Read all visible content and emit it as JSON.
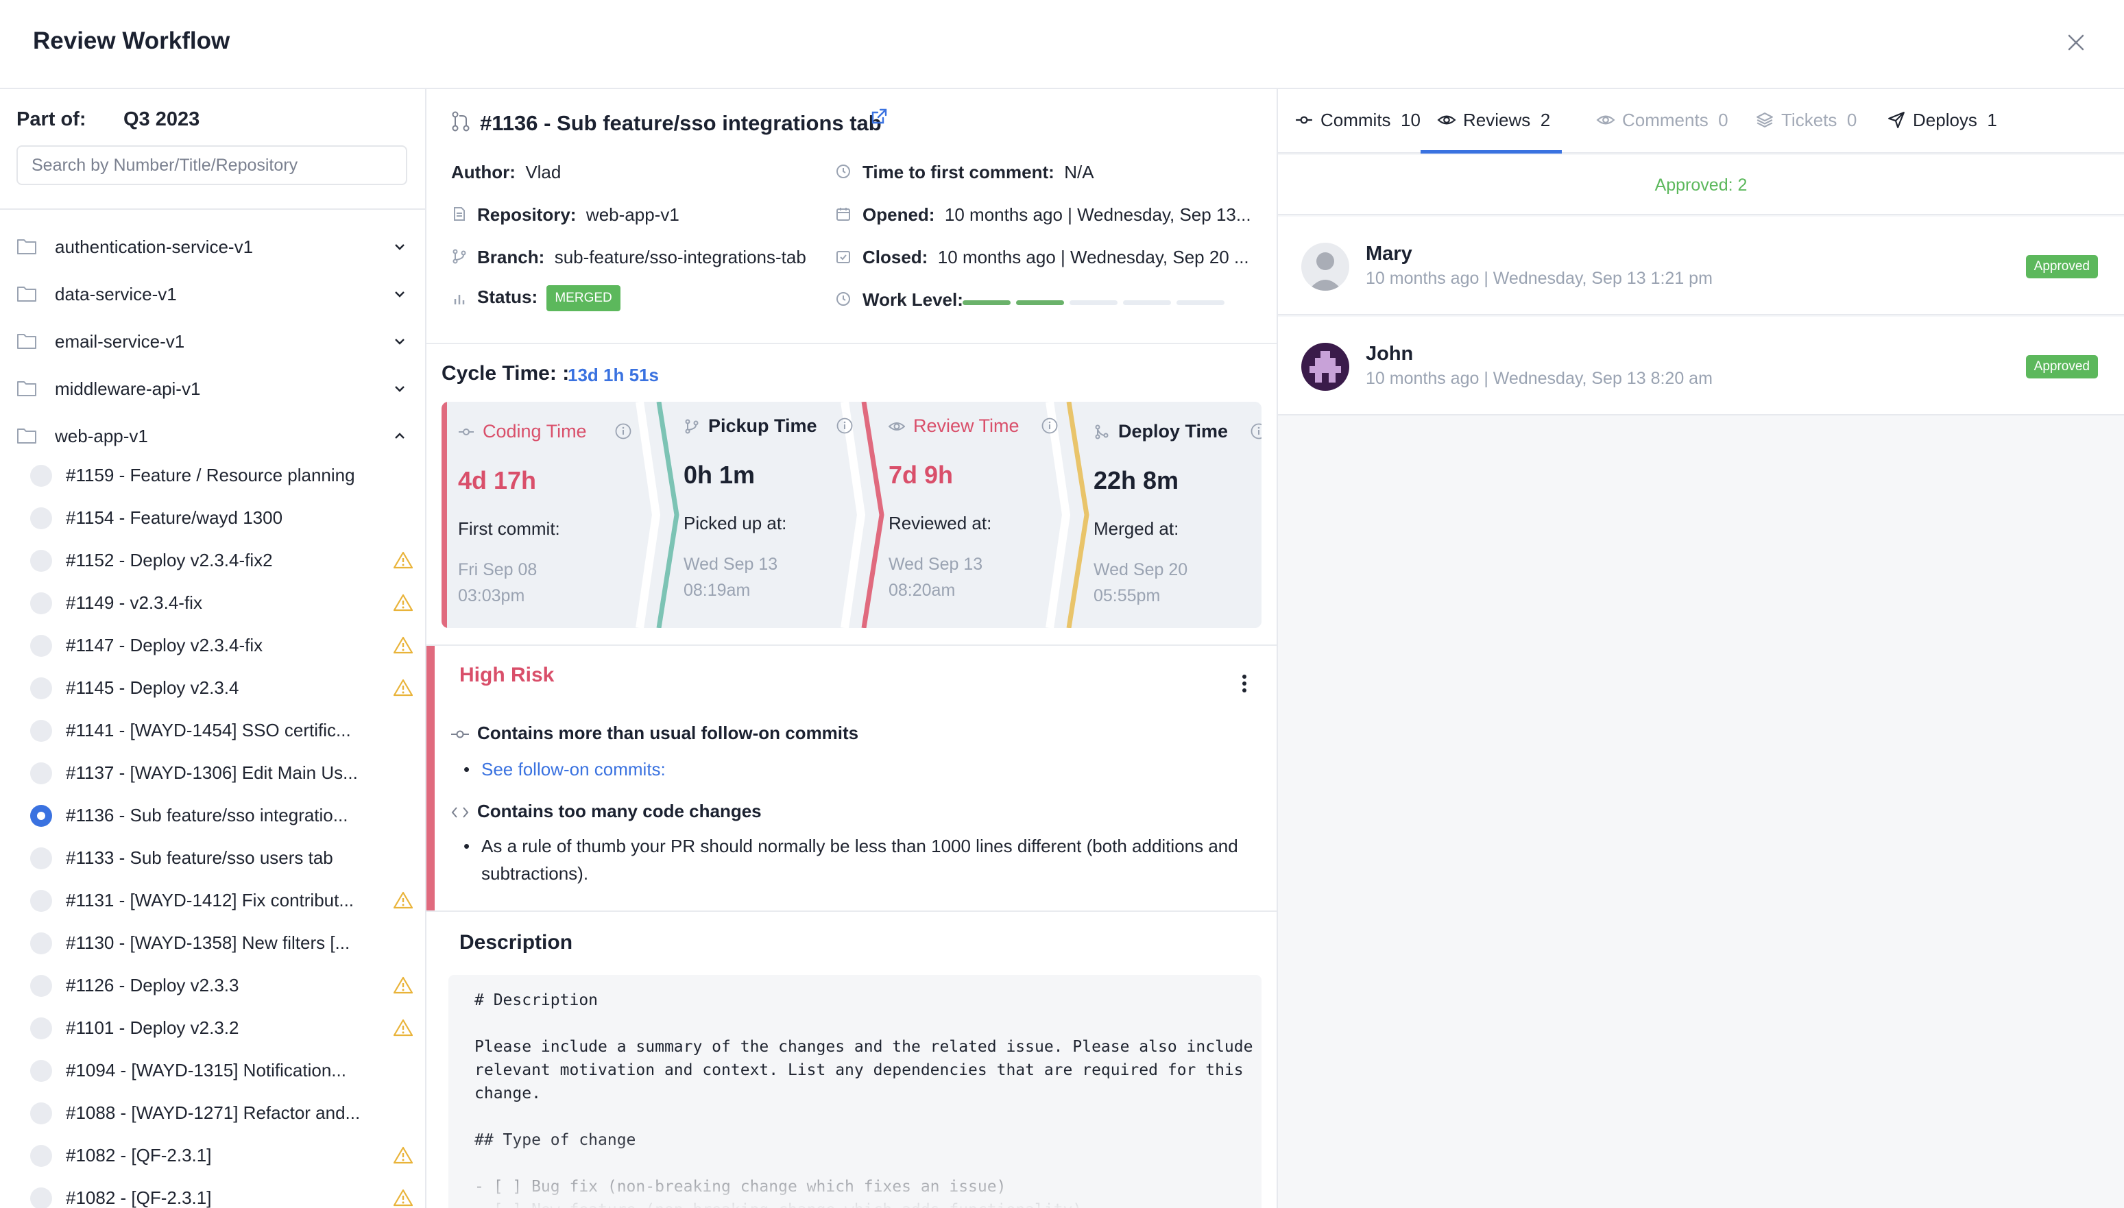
{
  "header": {
    "title": "Review Workflow"
  },
  "left": {
    "part_of_label": "Part of:",
    "part_of_value": "Q3 2023",
    "search_placeholder": "Search by Number/Title/Repository",
    "repos": [
      {
        "name": "authentication-service-v1",
        "expanded": false
      },
      {
        "name": "data-service-v1",
        "expanded": false
      },
      {
        "name": "email-service-v1",
        "expanded": false
      },
      {
        "name": "middleware-api-v1",
        "expanded": false
      },
      {
        "name": "web-app-v1",
        "expanded": true
      }
    ],
    "prs": [
      {
        "title": "#1159 - Feature / Resource planning",
        "warning": false,
        "selected": false
      },
      {
        "title": "#1154 - Feature/wayd 1300",
        "warning": false,
        "selected": false
      },
      {
        "title": "#1152 - Deploy v2.3.4-fix2",
        "warning": true,
        "selected": false
      },
      {
        "title": "#1149 - v2.3.4-fix",
        "warning": true,
        "selected": false
      },
      {
        "title": "#1147 - Deploy v2.3.4-fix",
        "warning": true,
        "selected": false
      },
      {
        "title": "#1145 - Deploy v2.3.4",
        "warning": true,
        "selected": false
      },
      {
        "title": "#1141 - [WAYD-1454] SSO certific...",
        "warning": false,
        "selected": false
      },
      {
        "title": "#1137 - [WAYD-1306] Edit Main Us...",
        "warning": false,
        "selected": false
      },
      {
        "title": "#1136 - Sub feature/sso integratio...",
        "warning": false,
        "selected": true
      },
      {
        "title": "#1133 - Sub feature/sso users tab",
        "warning": false,
        "selected": false
      },
      {
        "title": "#1131 - [WAYD-1412] Fix contribut...",
        "warning": true,
        "selected": false
      },
      {
        "title": "#1130 - [WAYD-1358] New filters [...",
        "warning": false,
        "selected": false
      },
      {
        "title": "#1126 - Deploy v2.3.3",
        "warning": true,
        "selected": false
      },
      {
        "title": "#1101 - Deploy v2.3.2",
        "warning": true,
        "selected": false
      },
      {
        "title": "#1094 - [WAYD-1315] Notification...",
        "warning": false,
        "selected": false
      },
      {
        "title": "#1088 - [WAYD-1271] Refactor and...",
        "warning": false,
        "selected": false
      },
      {
        "title": "#1082 - [QF-2.3.1]",
        "warning": true,
        "selected": false
      },
      {
        "title": "#1082 - [QF-2.3.1]",
        "warning": true,
        "selected": false
      }
    ]
  },
  "pr": {
    "title": "#1136 - Sub feature/sso integrations tab",
    "author_label": "Author:",
    "author": "Vlad",
    "repo_label": "Repository:",
    "repo": "web-app-v1",
    "branch_label": "Branch:",
    "branch": "sub-feature/sso-integrations-tab",
    "status_label": "Status:",
    "status": "MERGED",
    "ttfc_label": "Time to first comment:",
    "ttfc": "N/A",
    "opened_label": "Opened:",
    "opened": "10 months ago | Wednesday, Sep 13...",
    "closed_label": "Closed:",
    "closed": "10 months ago | Wednesday, Sep 20 ...",
    "work_level_label": "Work Level:",
    "work_level": 0.4
  },
  "cycle": {
    "title": "Cycle Time: :",
    "total": "13d 1h 51s",
    "stages": [
      {
        "name": "Coding Time",
        "value": "4d 17h",
        "label": "First commit:",
        "date1": "Fri Sep 08",
        "date2": "03:03pm",
        "color": "#e06a7e",
        "icon": "commit-icon"
      },
      {
        "name": "Pickup Time",
        "value": "0h 1m",
        "label": "Picked up at:",
        "date1": "Wed Sep 13",
        "date2": "08:19am",
        "color": "#7cc3b4",
        "icon": "branch-icon"
      },
      {
        "name": "Review Time",
        "value": "7d 9h",
        "label": "Reviewed at:",
        "date1": "Wed Sep 13",
        "date2": "08:20am",
        "color": "#e06a7e",
        "icon": "eye-icon"
      },
      {
        "name": "Deploy Time",
        "value": "22h 8m",
        "label": "Merged at:",
        "date1": "Wed Sep 20",
        "date2": "05:55pm",
        "color": "#e9c46a",
        "icon": "merge-icon"
      }
    ]
  },
  "risk": {
    "title": "High Risk",
    "item1": "Contains more than usual follow-on commits",
    "item1_link": "See follow-on commits:",
    "item2": "Contains too many code changes",
    "item2_bullet": "As a rule of thumb your PR should normally be less than 1000 lines different (both additions and subtractions)."
  },
  "description": {
    "title": "Description",
    "body": "# Description\n\nPlease include a summary of the changes and the related issue. Please also include\nrelevant motivation and context. List any dependencies that are required for this\nchange.\n\n## Type of change\n\n- [ ] Bug fix (non-breaking change which fixes an issue)\n- [ ] New feature (non-breaking change which adds functionality)"
  },
  "right": {
    "tabs": [
      {
        "label": "Commits",
        "count": "10",
        "icon": "commit-icon"
      },
      {
        "label": "Reviews",
        "count": "2",
        "icon": "eye-icon"
      },
      {
        "label": "Comments",
        "count": "0",
        "icon": "comment-icon"
      },
      {
        "label": "Tickets",
        "count": "0",
        "icon": "layers-icon"
      },
      {
        "label": "Deploys",
        "count": "1",
        "icon": "send-icon"
      }
    ],
    "approved_summary": "Approved: 2",
    "reviews": [
      {
        "name": "Mary",
        "time": "10 months ago | Wednesday, Sep 13 1:21 pm",
        "badge": "Approved"
      },
      {
        "name": "John",
        "time": "10 months ago | Wednesday, Sep 13 8:20 am",
        "badge": "Approved"
      }
    ]
  },
  "colors": {
    "accent": "#3a72e0",
    "approved": "#5cb85c",
    "risk": "#e06a7e",
    "muted": "#9aa3b2"
  }
}
